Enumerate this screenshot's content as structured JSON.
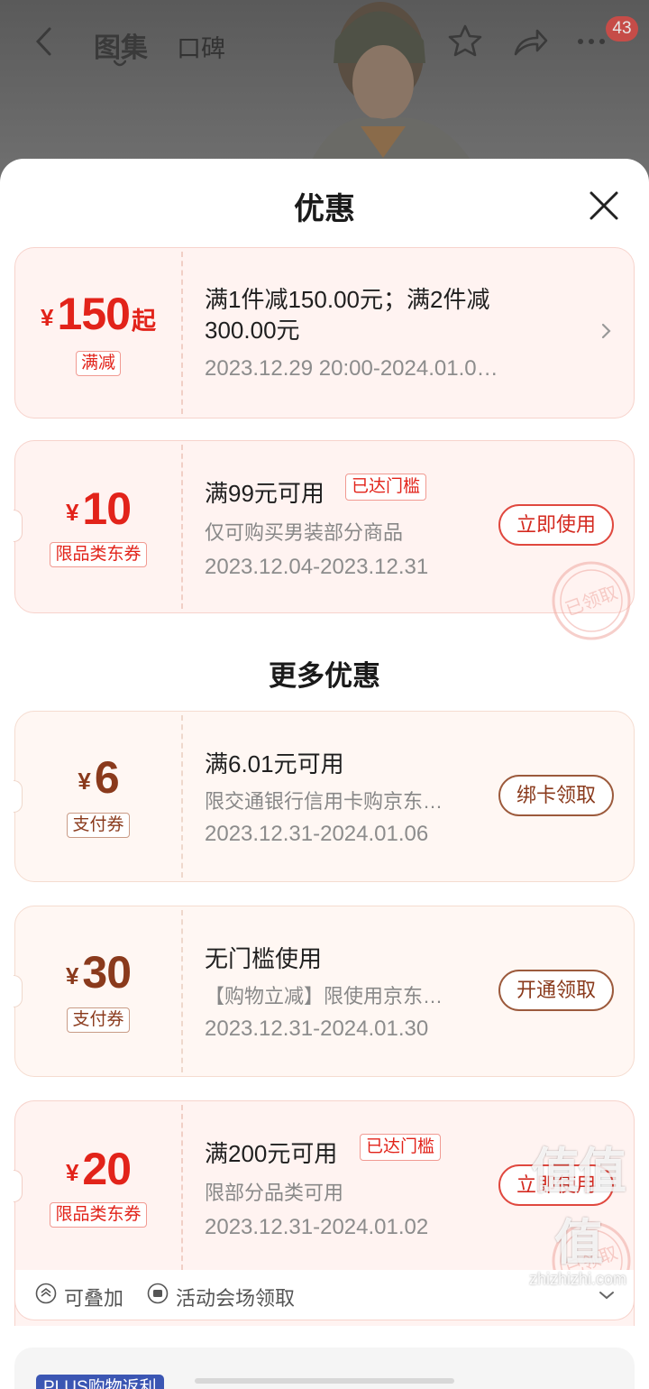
{
  "header": {
    "tabs": [
      {
        "label": "图集"
      },
      {
        "label": "口碑"
      }
    ],
    "badge_count": "43"
  },
  "sheet": {
    "title": "优惠",
    "coupons_top": [
      {
        "yen": "¥",
        "amount": "150",
        "suffix": "起",
        "tag": "满减",
        "title": "满1件减150.00元；满2件减300.00元",
        "date": "2023.12.29 20:00-2024.01.0…"
      },
      {
        "yen": "¥",
        "amount": "10",
        "tag": "限品类东券",
        "title": "满99元可用",
        "reached": "已达门槛",
        "desc": "仅可购买男装部分商品",
        "date": "2023.12.04-2023.12.31",
        "button": "立即使用",
        "stamp": "已领取"
      }
    ],
    "more_title": "更多优惠",
    "coupons_more": [
      {
        "yen": "¥",
        "amount": "6",
        "tag": "支付券",
        "title": "满6.01元可用",
        "desc": "限交通银行信用卡购京东…",
        "date": "2023.12.31-2024.01.06",
        "button": "绑卡领取"
      },
      {
        "yen": "¥",
        "amount": "30",
        "tag": "支付券",
        "title": "无门槛使用",
        "desc": "【购物立减】限使用京东…",
        "date": "2023.12.31-2024.01.30",
        "button": "开通领取"
      },
      {
        "yen": "¥",
        "amount": "20",
        "tag": "限品类东券",
        "title": "满200元可用",
        "reached": "已达门槛",
        "desc": "限部分品类可用",
        "date": "2023.12.31-2024.01.02",
        "button": "立即使用",
        "stamp": "已领取"
      }
    ],
    "footer": {
      "stackable": "可叠加",
      "venue": "活动会场领取"
    },
    "bottom_card": {
      "tag": "PLUS购物返利"
    }
  },
  "watermark": {
    "big": "值值值",
    "small": "zhizhizhi.com"
  },
  "colors": {
    "accent_red": "#e2231a",
    "accent_brown": "#8a3a1c",
    "coupon_bg": "#fff3f1"
  }
}
